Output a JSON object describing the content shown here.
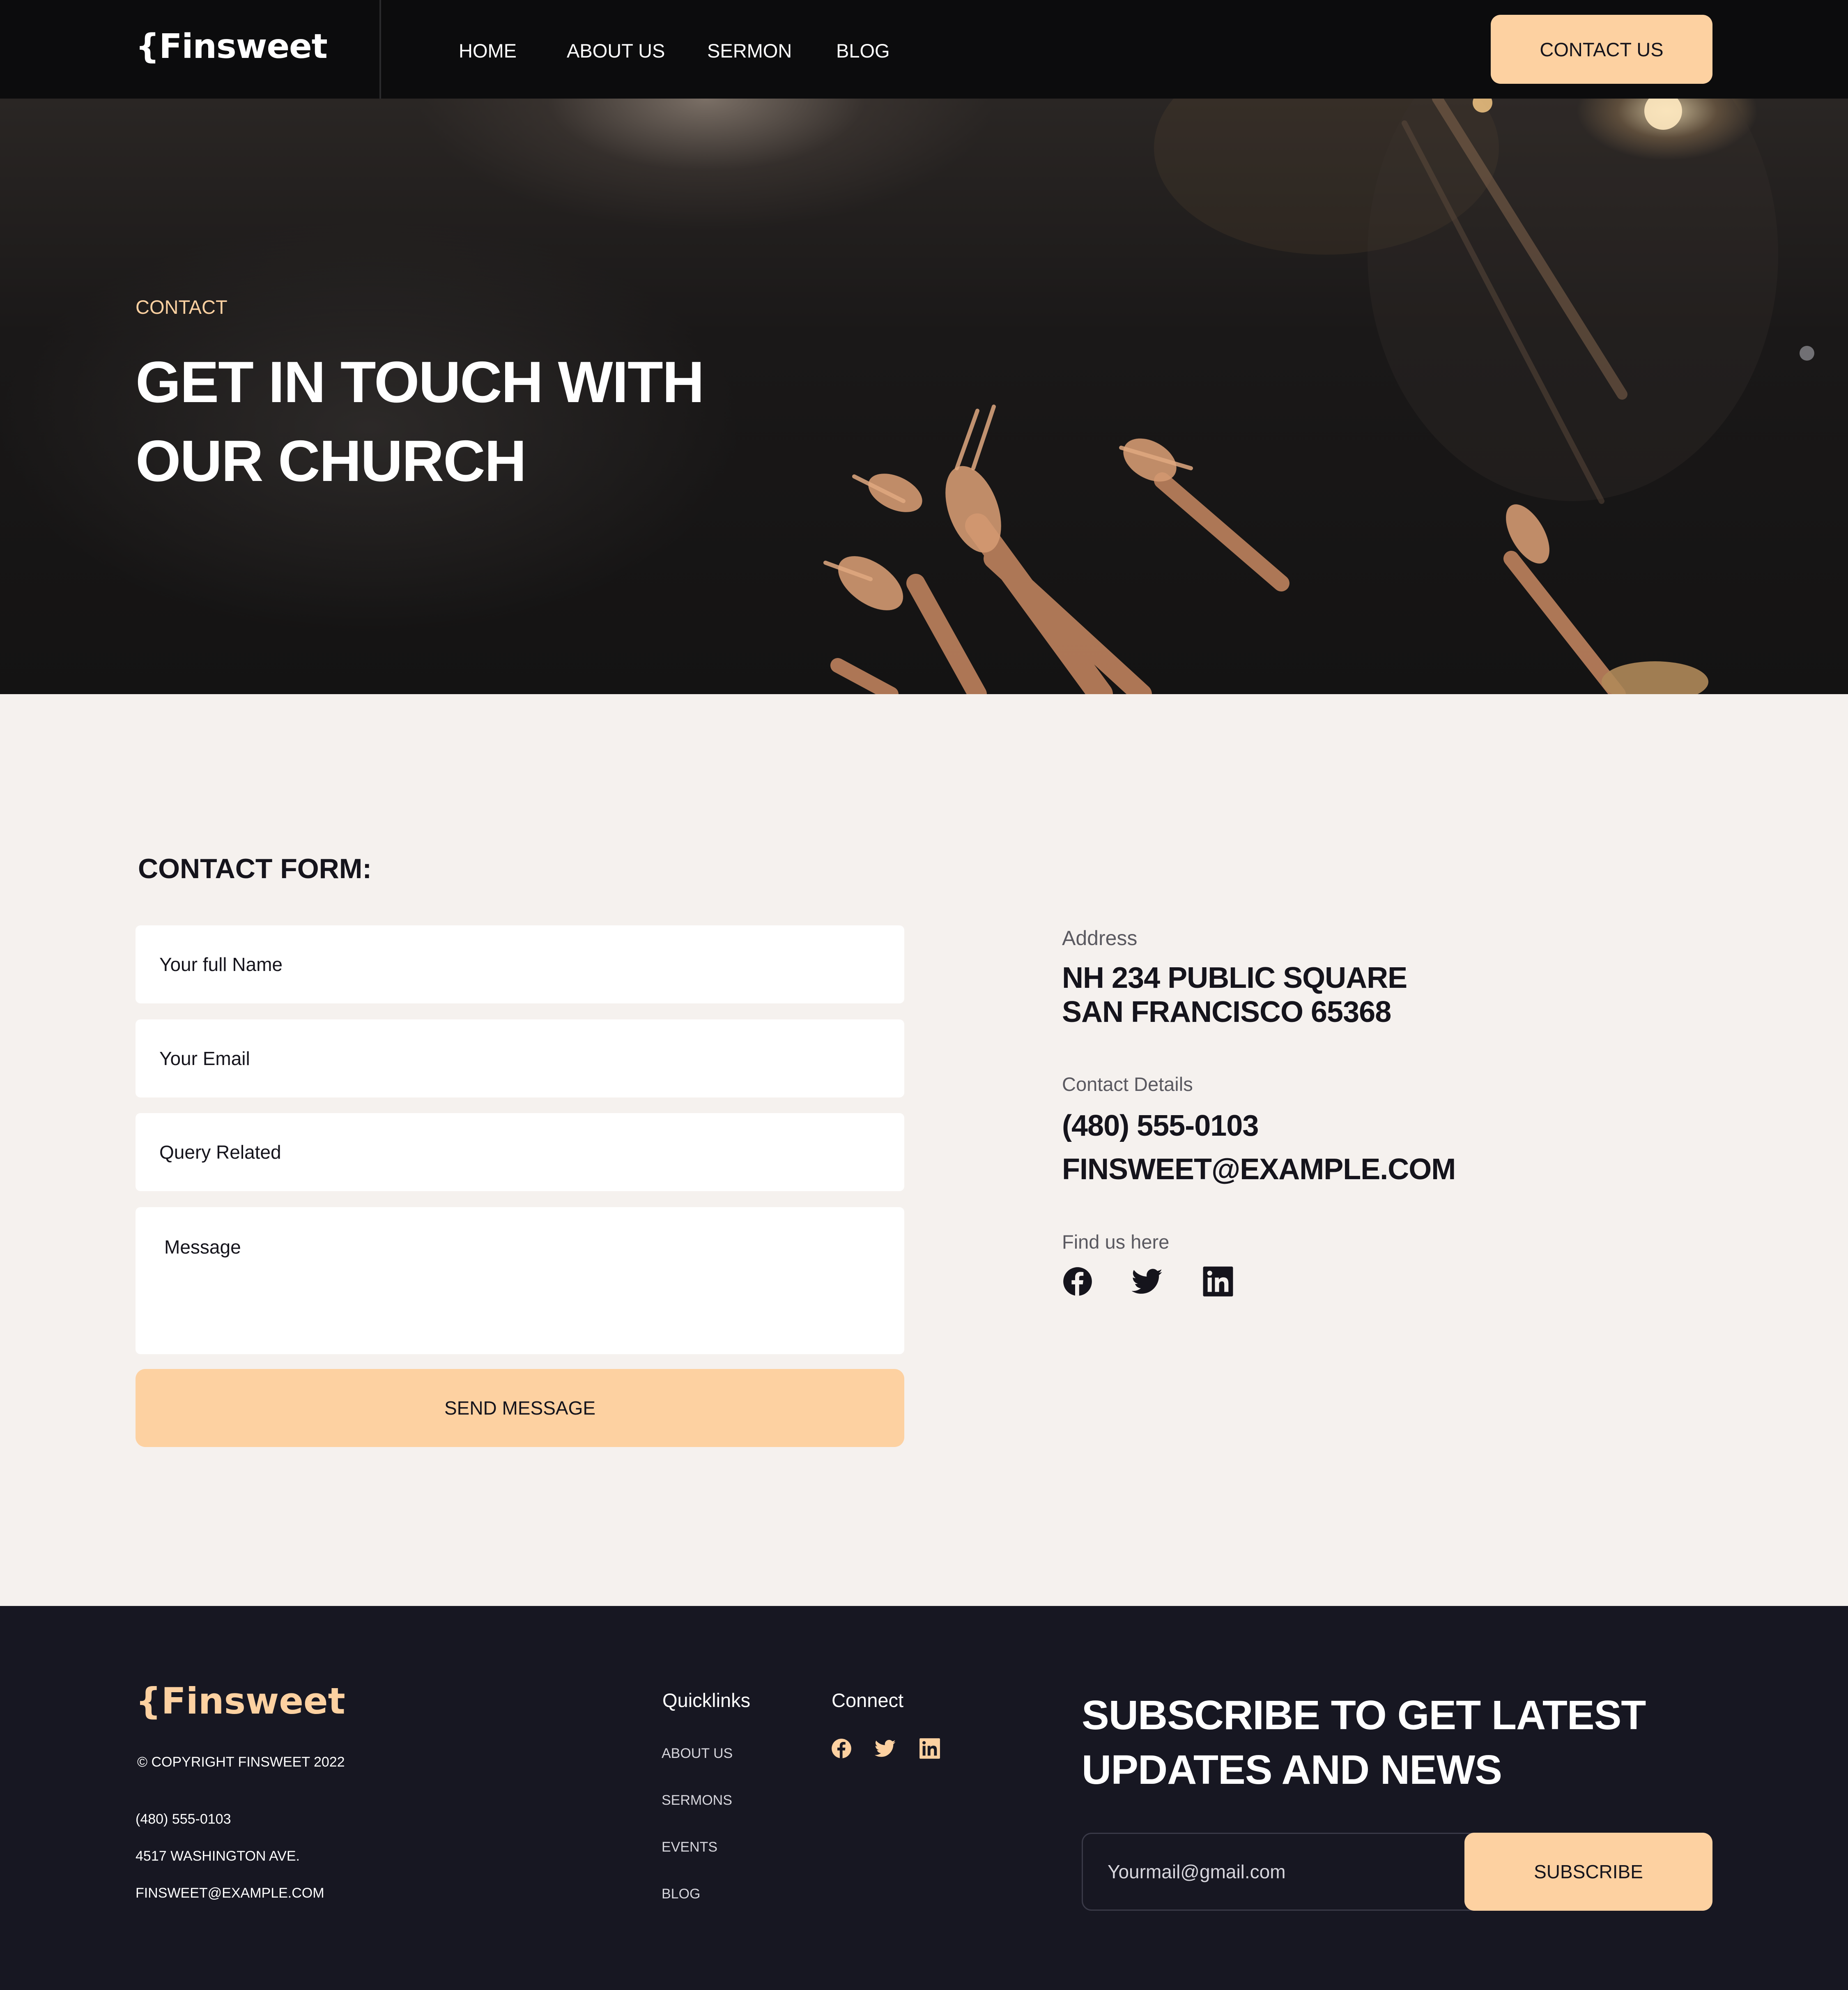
{
  "colors": {
    "accent": "#FDD1A1",
    "nav_bg": "#0C0C0D",
    "page_bg": "#F5F1EE",
    "footer_bg": "#171722",
    "text_dark": "#15141C"
  },
  "nav": {
    "logo": "{Finsweet",
    "links": [
      "HOME",
      "ABOUT US",
      "SERMON",
      "BLOG"
    ],
    "cta": "CONTACT US"
  },
  "hero": {
    "eyebrow": "CONTACT",
    "title_line1": "GET IN TOUCH WITH",
    "title_line2": "OUR CHURCH"
  },
  "contact_form": {
    "title": "CONTACT FORM:",
    "name_placeholder": "Your full Name",
    "email_placeholder": "Your Email",
    "query_placeholder": "Query Related",
    "message_placeholder": "Message",
    "submit": "SEND MESSAGE"
  },
  "contact_info": {
    "address_label": "Address",
    "address_line1": "NH 234   PUBLIC SQUARE",
    "address_line2": "SAN FRANCISCO  65368",
    "details_label": "Contact Details",
    "phone": "(480) 555-0103",
    "email": "FINSWEET@EXAMPLE.COM",
    "find_label": "Find us here",
    "social_icons": [
      "facebook-icon",
      "twitter-icon",
      "linkedin-icon"
    ]
  },
  "footer": {
    "logo": "{Finsweet",
    "copyright": "© COPYRIGHT FINSWEET 2022",
    "phone": "(480) 555-0103",
    "address": "4517 WASHINGTON AVE.",
    "email": "FINSWEET@EXAMPLE.COM",
    "quicklinks_title": "Quicklinks",
    "quicklinks": [
      "ABOUT US",
      "SERMONS",
      "EVENTS",
      "BLOG"
    ],
    "connect_title": "Connect",
    "connect_icons": [
      "facebook-icon",
      "twitter-icon",
      "linkedin-icon"
    ],
    "subscribe_heading_line1": "SUBSCRIBE TO GET LATEST",
    "subscribe_heading_line2": "UPDATES AND NEWS",
    "email_placeholder": "Yourmail@gmail.com",
    "subscribe_button": "SUBSCRIBE"
  }
}
